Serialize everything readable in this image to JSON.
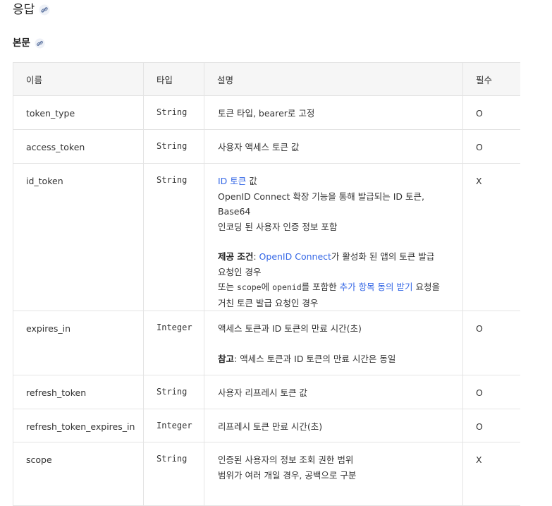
{
  "heading": "응답",
  "subheading": "본문",
  "headers": [
    "이름",
    "타입",
    "설명",
    "필수"
  ],
  "rows": [
    {
      "name": "token_type",
      "type": "String",
      "desc": "토큰 타입, bearer로 고정",
      "required": "O"
    },
    {
      "name": "access_token",
      "type": "String",
      "desc": "사용자 액세스 토큰 값",
      "required": "O"
    },
    {
      "name": "id_token",
      "type": "String",
      "required": "X",
      "desc_link": "ID 토큰",
      "desc_after_link": " 값",
      "desc_line2": "OpenID Connect 확장 기능을 통해 발급되는 ID 토큰, Base64",
      "desc_line3": "인코딩 된 사용자 인증 정보 포함",
      "cond_label": "제공 조건",
      "cond_colon": ": ",
      "cond_link": "OpenID Connect",
      "cond_rest": "가 활성화 된 앱의 토큰 발급",
      "cond_line2": "요청인 경우",
      "cond_line3_pre": "또는 ",
      "cond_scope": "scope",
      "cond_line3_mid": "에 ",
      "cond_openid": "openid",
      "cond_line3_mid2": "를 포함한 ",
      "cond_link2": "추가 항목 동의 받기",
      "cond_line3_post": " 요청을",
      "cond_line4": "거친 토큰 발급 요청인 경우"
    },
    {
      "name": "expires_in",
      "type": "Integer",
      "required": "O",
      "desc": "액세스 토큰과 ID 토큰의 만료 시간(초)",
      "note_label": "참고",
      "note_text": ": 액세스 토큰과 ID 토큰의 만료 시간은 동일"
    },
    {
      "name": "refresh_token",
      "type": "String",
      "desc": "사용자 리프레시 토큰 값",
      "required": "O"
    },
    {
      "name": "refresh_token_expires_in",
      "type": "Integer",
      "desc": "리프레시 토큰 만료 시간(초)",
      "required": "O"
    },
    {
      "name": "scope",
      "type": "String",
      "desc": "인증된 사용자의 정보 조회 권한 범위",
      "desc_line2": "범위가 여러 개일 경우, 공백으로 구분",
      "required": "X"
    }
  ]
}
